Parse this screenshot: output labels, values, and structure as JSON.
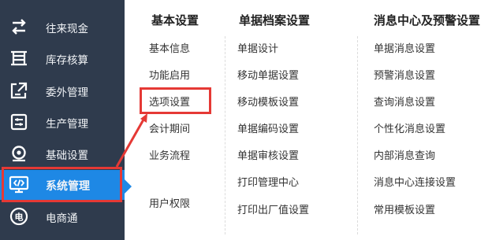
{
  "sidebar": {
    "items": [
      {
        "label": "往来现金",
        "icon": "exchange-icon"
      },
      {
        "label": "库存核算",
        "icon": "warehouse-icon"
      },
      {
        "label": "委外管理",
        "icon": "outsourcing-icon"
      },
      {
        "label": "生产管理",
        "icon": "production-icon"
      },
      {
        "label": "基础设置",
        "icon": "settings-icon"
      },
      {
        "label": "系统管理",
        "icon": "code-icon",
        "active": true
      },
      {
        "label": "电商通",
        "icon": "ecommerce-icon"
      }
    ]
  },
  "menu": {
    "columns": [
      {
        "title": "基本设置",
        "items": [
          "基本信息",
          "功能启用",
          "选项设置",
          "会计期间",
          "业务流程",
          "用户权限"
        ]
      },
      {
        "title": "单据档案设置",
        "items": [
          "单据设计",
          "移动单据设置",
          "移动模板设置",
          "单据编码设置",
          "单据审核设置",
          "打印管理中心",
          "打印出厂值设置"
        ]
      },
      {
        "title": "消息中心及预警设置",
        "items": [
          "单据消息设置",
          "预警消息设置",
          "查询消息设置",
          "个性化消息设置",
          "内部消息查询",
          "消息中心连接设置",
          "常用模板设置"
        ]
      }
    ]
  },
  "colors": {
    "sidebar_bg": "#2f3b4d",
    "active_bg": "#1e88e5",
    "highlight": "#e53935"
  }
}
